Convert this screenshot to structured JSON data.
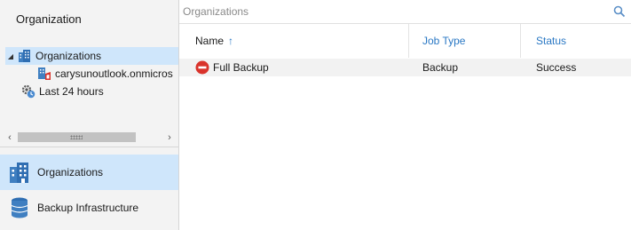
{
  "left_header": {
    "title": "Organization"
  },
  "tree": {
    "items": [
      {
        "label": "Organizations",
        "icon": "building-icon",
        "expanded": true,
        "selected": true
      },
      {
        "label": "carysunoutlook.onmicros",
        "icon": "office365-org-icon"
      },
      {
        "label": "Last 24 hours",
        "icon": "gear-clock-icon"
      }
    ]
  },
  "nav": {
    "items": [
      {
        "label": "Organizations",
        "icon": "building-icon",
        "active": true
      },
      {
        "label": "Backup Infrastructure",
        "icon": "database-icon",
        "active": false
      }
    ]
  },
  "search": {
    "placeholder": "Organizations",
    "value": ""
  },
  "table": {
    "columns": [
      {
        "label": "Name",
        "sorted": "ascending"
      },
      {
        "label": "Job Type"
      },
      {
        "label": "Status"
      }
    ],
    "rows": [
      {
        "name": "Full Backup",
        "job_type": "Backup",
        "status": "Success",
        "icon": "stop-icon"
      }
    ]
  },
  "colors": {
    "selection": "#cfe6fb",
    "header_blue": "#2a78c4",
    "stop_red": "#d9332b"
  }
}
